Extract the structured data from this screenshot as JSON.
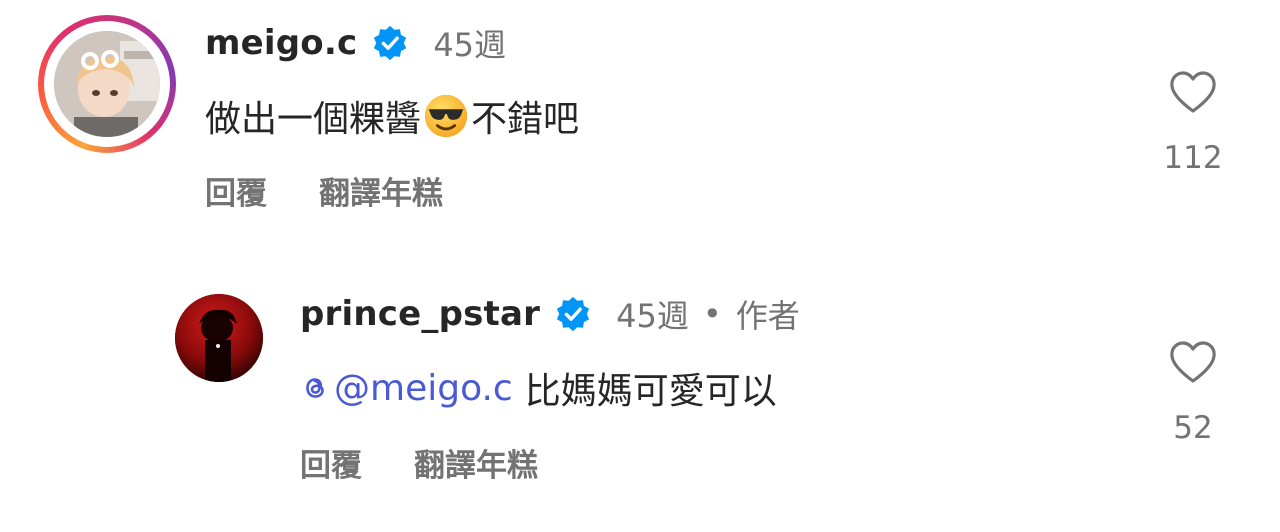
{
  "comments": [
    {
      "username": "meigo.c",
      "verified": true,
      "time": "45週",
      "text_before": "做出一個粿醬",
      "emoji": "smiling-face-with-sunglasses",
      "text_after": "不錯吧",
      "actions": {
        "reply": "回覆",
        "translate": "翻譯年糕"
      },
      "likes": "112",
      "has_story_ring": true
    },
    {
      "username": "prince_pstar",
      "verified": true,
      "time": "45週",
      "separator": "•",
      "author_tag": "作者",
      "mention": "@meigo.c",
      "text": "比媽媽可愛可以",
      "actions": {
        "reply": "回覆",
        "translate": "翻譯年糕"
      },
      "likes": "52"
    }
  ],
  "colors": {
    "text_primary": "#262626",
    "text_secondary": "#737373",
    "verified_blue": "#0095f6",
    "mention_blue": "#4a5ad6"
  }
}
